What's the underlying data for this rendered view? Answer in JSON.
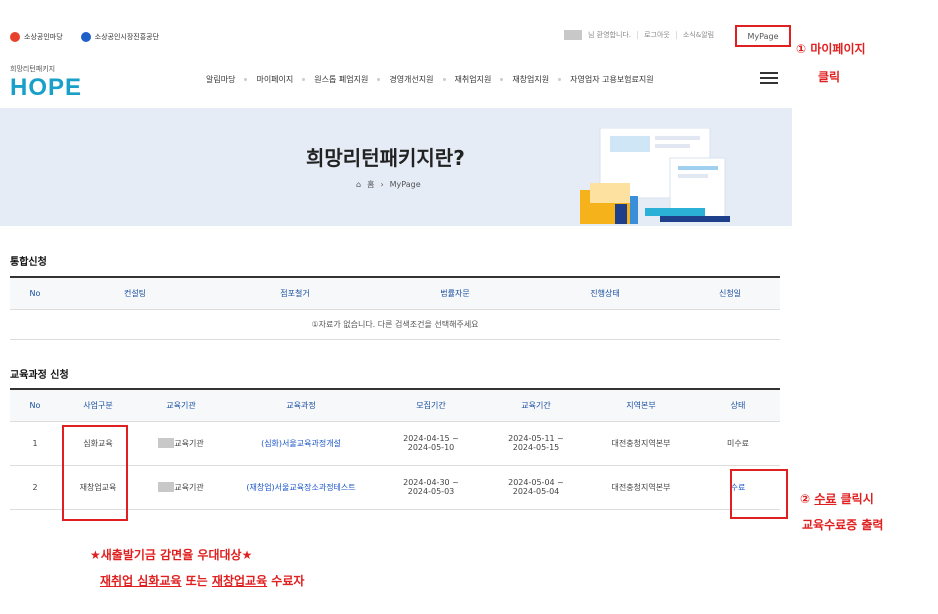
{
  "topbar": {
    "brand1": "소상공인마당",
    "brand2": "소상공인시장진흥공단",
    "welcome": "님 환영합니다.",
    "logout": "로그아웃",
    "news": "소식&알림",
    "mypage": "MyPage",
    "colors": {
      "brand1": "#e7412b",
      "brand2": "#1f5fc8"
    }
  },
  "header": {
    "logo_small": "희망리턴패키지",
    "logo_big": "HOPE",
    "nav": [
      "알림마당",
      "마이페이지",
      "원스톱 폐업지원",
      "경영개선지원",
      "재취업지원",
      "재창업지원",
      "자영업자 고용보험료지원"
    ]
  },
  "hero": {
    "title": "희망리턴패키지란?",
    "crumb_home": "홈",
    "crumb_current": "MyPage"
  },
  "integrated": {
    "title": "통합신청",
    "headers": [
      "No",
      "컨설팅",
      "점포철거",
      "법률자문",
      "진행상태",
      "신청일"
    ],
    "empty": "①자료가 없습니다. 다른 검색조건을 선택해주세요"
  },
  "education": {
    "title": "교육과정 신청",
    "headers": [
      "No",
      "사업구분",
      "교육기관",
      "교육과정",
      "모집기간",
      "교육기간",
      "지역본부",
      "상태"
    ],
    "rows": [
      {
        "no": "1",
        "type": "심화교육",
        "org": "교육기관",
        "course": "(심화)서울교육과정개설",
        "recruit": "2024-04-15 ~\n2024-05-10",
        "period": "2024-05-11 ~\n2024-05-15",
        "region": "대전충청지역본부",
        "status": "미수료"
      },
      {
        "no": "2",
        "type": "재창업교육",
        "org": "교육기관",
        "course": "(재창업)서울교육장소과정테스트",
        "recruit": "2024-04-30 ~\n2024-05-03",
        "period": "2024-05-04 ~\n2024-05-04",
        "region": "대전충청지역본부",
        "status": "수료"
      }
    ]
  },
  "annotations": {
    "a1_line1": "① 마이페이지",
    "a1_line2": "클릭",
    "a2_prefix": "② ",
    "a2_link": "수료",
    "a2_suffix": " 클릭시",
    "a2_line2": "교육수료증 출력",
    "note1": "★새출발기금 감면율 우대대상★",
    "note2_a": "재취업 심화교육",
    "note2_b": " 또는 ",
    "note2_c": "재창업교육",
    "note2_d": " 수료자"
  }
}
